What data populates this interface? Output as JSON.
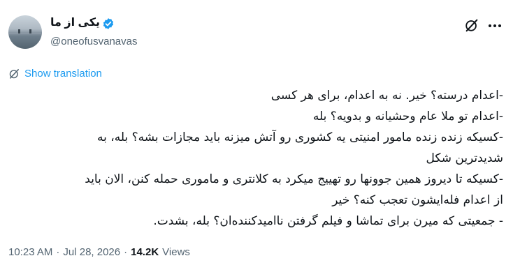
{
  "author": {
    "name": "یکی از ما",
    "handle": "@oneofusvanavas"
  },
  "icons": {
    "verified": "verified-badge-icon",
    "grok": "grok-icon",
    "more": "more-icon",
    "translate": "translate-icon"
  },
  "colors": {
    "accent": "#1d9bf0",
    "secondary_text": "#536471",
    "primary_text": "#0f1419"
  },
  "translate_label": "Show translation",
  "tweet_lines": [
    "-اعدام درسته؟ خیر. نه به اعدام، برای هر کسی",
    "-اعدام تو ملا عام وحشیانه و بدویه؟ بله",
    "-کسیکه زنده زنده مامور امنیتی یه کشوری رو آتش میزنه باید مجازات بشه؟ بله، به",
    "شدیدترین شکل",
    "-کسیکه تا دیروز همین جوونها رو تهییج میکرد به کلانتری و ماموری حمله کنن، الان باید",
    "از اعدام فله‌ایشون تعجب کنه؟ خیر",
    "- جمعیتی که میرن برای تماشا و فیلم گرفتن ناامیدکننده‌ان؟ بله، بشدت."
  ],
  "meta": {
    "time": "10:23 AM",
    "separator1": "·",
    "date": "Jul 28, 2026",
    "separator2": "·",
    "views_count": "14.2K",
    "views_label": "Views"
  }
}
